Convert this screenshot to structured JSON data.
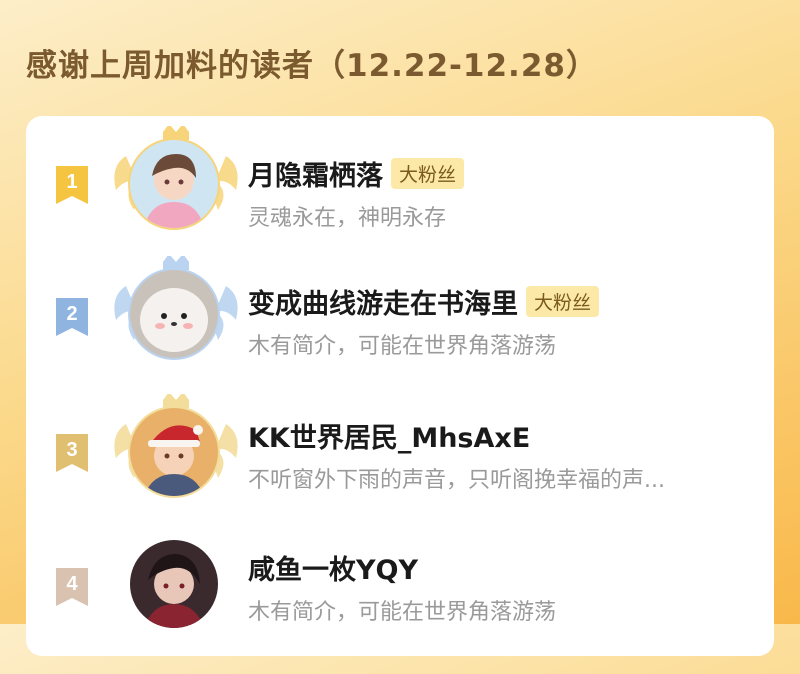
{
  "header": {
    "title": "感谢上周加料的读者（12.22-12.28）"
  },
  "readers": [
    {
      "rank": "1",
      "name": "月隐霜栖落",
      "badge": "大粉丝",
      "bio": "灵魂永在，神明永存",
      "avatar_icon": "anime-boy-avatar"
    },
    {
      "rank": "2",
      "name": "变成曲线游走在书海里",
      "badge": "大粉丝",
      "bio": "木有简介，可能在世界角落游荡",
      "avatar_icon": "white-puppy-avatar"
    },
    {
      "rank": "3",
      "name": "KK世界居民_MhsAxE",
      "badge": "",
      "bio": "不听窗外下雨的声音，只听阁挽幸福的声...",
      "avatar_icon": "christmas-hat-avatar"
    },
    {
      "rank": "4",
      "name": "咸鱼一枚YQY",
      "badge": "",
      "bio": "木有简介，可能在世界角落游荡",
      "avatar_icon": "dark-anime-avatar"
    }
  ],
  "colors": {
    "rank1": "#f5c542",
    "rank2": "#8fb4e0",
    "rank3": "#e0c070",
    "rank4": "#d9c3b0",
    "wing_gold": "#f7d479",
    "wing_blue": "#b9d3f0",
    "badge_bg": "#fde9a7"
  }
}
